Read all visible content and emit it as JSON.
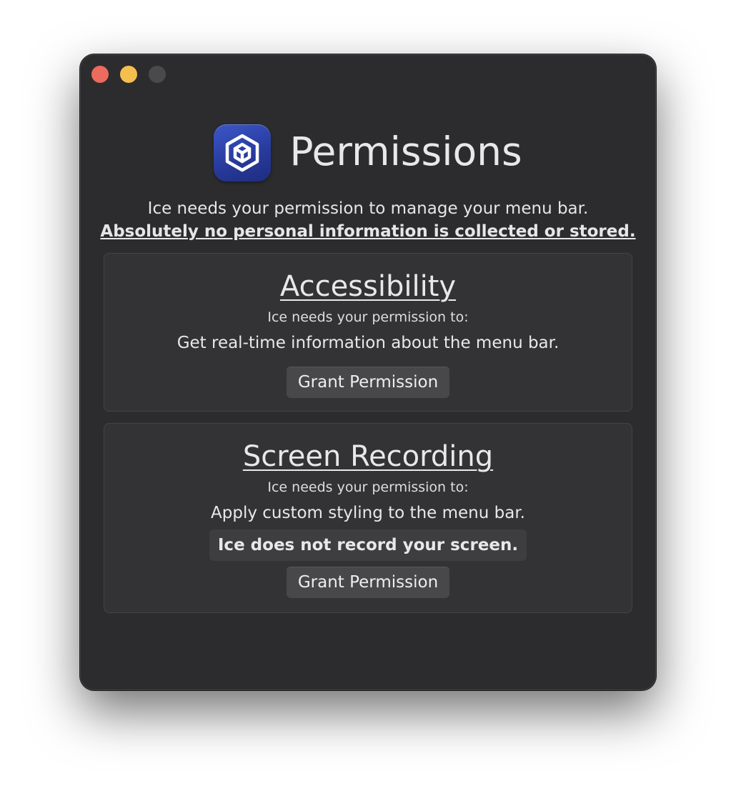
{
  "window": {
    "traffic_lights": [
      "close",
      "minimize",
      "zoom"
    ]
  },
  "header": {
    "icon": "ice-cube-icon",
    "title": "Permissions"
  },
  "intro": {
    "line1": "Ice needs your permission to manage your menu bar.",
    "line2": "Absolutely no personal information is collected or stored."
  },
  "permissions": [
    {
      "title": "Accessibility",
      "subtitle": "Ice needs your permission to:",
      "description": "Get real-time information about the menu bar.",
      "button_label": "Grant Permission"
    },
    {
      "title": "Screen Recording",
      "subtitle": "Ice needs your permission to:",
      "description": "Apply custom styling to the menu bar.",
      "note": "Ice does not record your screen.",
      "button_label": "Grant Permission"
    }
  ],
  "colors": {
    "window_bg": "#2c2c2e",
    "card_bg": "#333335",
    "button_bg": "#48484b",
    "icon_gradient_top": "#3b57c9",
    "icon_gradient_bottom": "#1e2d80",
    "close": "#ec6a5e",
    "minimize": "#f4bf4f",
    "zoom_disabled": "#4a4a4c"
  }
}
